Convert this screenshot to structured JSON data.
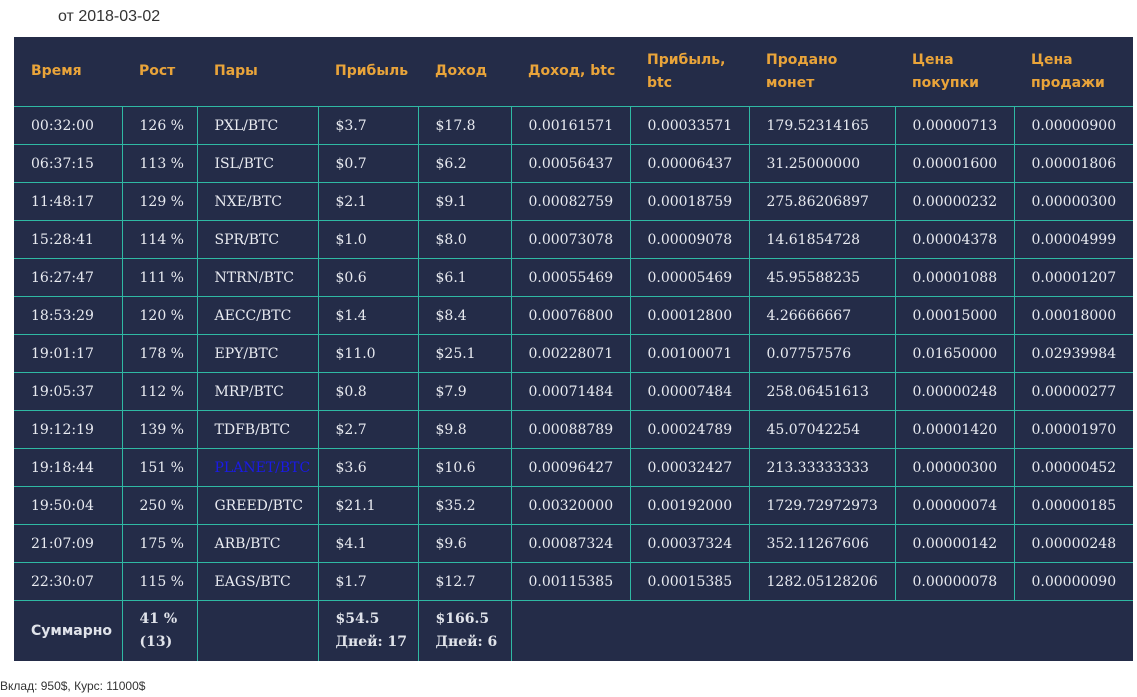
{
  "report": {
    "date_line": "от 2018-03-02"
  },
  "table": {
    "headers": [
      [
        "Время"
      ],
      [
        "Рост"
      ],
      [
        "Пары"
      ],
      [
        "Прибыль"
      ],
      [
        "Доход"
      ],
      [
        "Доход, btc"
      ],
      [
        "Прибыль,",
        "btc"
      ],
      [
        "Продано",
        "монет"
      ],
      [
        "Цена",
        "покупки"
      ],
      [
        "Цена",
        "продажи"
      ]
    ],
    "rows": [
      [
        "00:32:00",
        "126 %",
        "PXL/BTC",
        "$3.7",
        "$17.8",
        "0.00161571",
        "0.00033571",
        "179.52314165",
        "0.00000713",
        "0.00000900"
      ],
      [
        "06:37:15",
        "113 %",
        "ISL/BTC",
        "$0.7",
        "$6.2",
        "0.00056437",
        "0.00006437",
        "31.25000000",
        "0.00001600",
        "0.00001806"
      ],
      [
        "11:48:17",
        "129 %",
        "NXE/BTC",
        "$2.1",
        "$9.1",
        "0.00082759",
        "0.00018759",
        "275.86206897",
        "0.00000232",
        "0.00000300"
      ],
      [
        "15:28:41",
        "114 %",
        "SPR/BTC",
        "$1.0",
        "$8.0",
        "0.00073078",
        "0.00009078",
        "14.61854728",
        "0.00004378",
        "0.00004999"
      ],
      [
        "16:27:47",
        "111 %",
        "NTRN/BTC",
        "$0.6",
        "$6.1",
        "0.00055469",
        "0.00005469",
        "45.95588235",
        "0.00001088",
        "0.00001207"
      ],
      [
        "18:53:29",
        "120 %",
        "AECC/BTC",
        "$1.4",
        "$8.4",
        "0.00076800",
        "0.00012800",
        "4.26666667",
        "0.00015000",
        "0.00018000"
      ],
      [
        "19:01:17",
        "178 %",
        "EPY/BTC",
        "$11.0",
        "$25.1",
        "0.00228071",
        "0.00100071",
        "0.07757576",
        "0.01650000",
        "0.02939984"
      ],
      [
        "19:05:37",
        "112 %",
        "MRP/BTC",
        "$0.8",
        "$7.9",
        "0.00071484",
        "0.00007484",
        "258.06451613",
        "0.00000248",
        "0.00000277"
      ],
      [
        "19:12:19",
        "139 %",
        "TDFB/BTC",
        "$2.7",
        "$9.8",
        "0.00088789",
        "0.00024789",
        "45.07042254",
        "0.00001420",
        "0.00001970"
      ],
      [
        "19:18:44",
        "151 %",
        "PLANET/BTC",
        "$3.6",
        "$10.6",
        "0.00096427",
        "0.00032427",
        "213.33333333",
        "0.00000300",
        "0.00000452"
      ],
      [
        "19:50:04",
        "250 %",
        "GREED/BTC",
        "$21.1",
        "$35.2",
        "0.00320000",
        "0.00192000",
        "1729.72972973",
        "0.00000074",
        "0.00000185"
      ],
      [
        "21:07:09",
        "175 %",
        "ARB/BTC",
        "$4.1",
        "$9.6",
        "0.00087324",
        "0.00037324",
        "352.11267606",
        "0.00000142",
        "0.00000248"
      ],
      [
        "22:30:07",
        "115 %",
        "EAGS/BTC",
        "$1.7",
        "$12.7",
        "0.00115385",
        "0.00015385",
        "1282.05128206",
        "0.00000078",
        "0.00000090"
      ]
    ],
    "link_pair_index": 9,
    "summary": {
      "label": "Суммарно",
      "growth_line1": "41 %",
      "growth_line2": "(13)",
      "profit_line1": "$54.5",
      "profit_line2": "Дней: 17",
      "income_line1": "$166.5",
      "income_line2": "Дней: 6"
    }
  },
  "footer": {
    "text": "Вклад: 950$, Курс: 11000$"
  },
  "colors": {
    "table_bg": "#242c48",
    "header_text": "#e9a43a",
    "grid_lines": "#2fb9a3",
    "cell_text": "#e8eaf0",
    "link_text": "#1a1ae8"
  }
}
